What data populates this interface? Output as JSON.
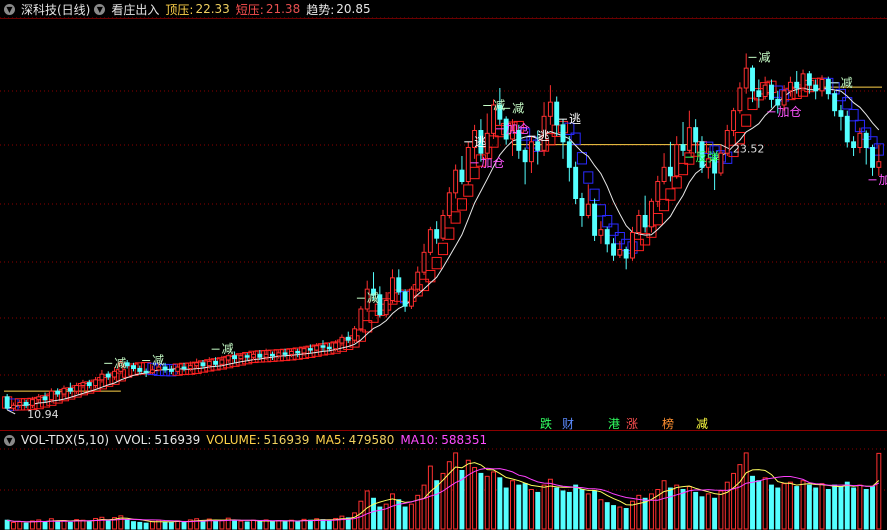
{
  "header": {
    "stock_title": "深科技(日线)",
    "indicator_name": "看庄出入",
    "top_label": "顶压:",
    "top_value": "22.33",
    "short_label": "短压:",
    "short_value": "21.38",
    "trend_label": "趋势:",
    "trend_value": "20.85"
  },
  "volume_header": {
    "indicator": "VOL-TDX(5,10)",
    "vvol_label": "VVOL:",
    "vvol_value": "516939",
    "volume_label": "VOLUME:",
    "volume_value": "516939",
    "ma5_label": "MA5:",
    "ma5_value": "479580",
    "ma10_label": "MA10:",
    "ma10_value": "588351"
  },
  "colors": {
    "up": "#ff3030",
    "down": "#54ffff",
    "box_red": "#ff2020",
    "box_blue": "#2a2aff",
    "ma_white": "#e8e8e8",
    "grid": "#8b0000",
    "label_reduce": "#c8ffc8",
    "label_escape": "#ffffff",
    "label_add": "#ff55ff",
    "label_rebound": "#30ff60",
    "ma5": "#ffff60",
    "ma10": "#ff40ff"
  },
  "chart_data": {
    "type": "candlestick",
    "high_label": "23.52",
    "low_label": "10.94",
    "signals": [
      {
        "text": "减",
        "kind": "reduce"
      },
      {
        "text": "减",
        "kind": "reduce"
      },
      {
        "text": "减",
        "kind": "reduce"
      },
      {
        "text": "减",
        "kind": "reduce"
      },
      {
        "text": "逃",
        "kind": "escape"
      },
      {
        "text": "减",
        "kind": "reduce"
      },
      {
        "text": "加仓",
        "kind": "add"
      },
      {
        "text": "加仓",
        "kind": "add"
      },
      {
        "text": "减",
        "kind": "reduce"
      },
      {
        "text": "逃",
        "kind": "escape"
      },
      {
        "text": "反弹",
        "kind": "rebound"
      },
      {
        "text": "加仓",
        "kind": "add"
      },
      {
        "text": "减",
        "kind": "reduce"
      },
      {
        "text": "加仓",
        "kind": "add"
      },
      {
        "text": "减",
        "kind": "reduce"
      },
      {
        "text": "逃",
        "kind": "escape"
      }
    ],
    "events": [
      {
        "text": "跌",
        "color": "#30ff60"
      },
      {
        "text": "财",
        "color": "#5b8bff"
      },
      {
        "text": "港",
        "color": "#30ff60"
      },
      {
        "text": "涨",
        "color": "#ff5050"
      },
      {
        "text": "榜",
        "color": "#ff9030"
      },
      {
        "text": "减",
        "color": "#ffff40"
      }
    ],
    "price_range": [
      10.3,
      24.7
    ],
    "volume_range": [
      0,
      540000
    ],
    "grid": true,
    "hlines": [
      20.3,
      22.33,
      11.6
    ],
    "candles": [
      [
        11.4,
        11.0,
        11.5,
        10.94
      ],
      [
        11.0,
        11.1,
        11.2,
        10.9
      ],
      [
        11.1,
        11.2,
        11.3,
        11.0
      ],
      [
        11.2,
        11.1,
        11.3,
        11.0
      ],
      [
        11.1,
        11.3,
        11.4,
        11.0
      ],
      [
        11.3,
        11.4,
        11.5,
        11.2
      ],
      [
        11.4,
        11.3,
        11.55,
        11.2
      ],
      [
        11.3,
        11.6,
        11.7,
        11.2
      ],
      [
        11.6,
        11.5,
        11.7,
        11.4
      ],
      [
        11.5,
        11.7,
        11.8,
        11.4
      ],
      [
        11.7,
        11.6,
        11.9,
        11.5
      ],
      [
        11.6,
        11.8,
        11.9,
        11.5
      ],
      [
        11.8,
        11.9,
        12.0,
        11.7
      ],
      [
        11.9,
        11.8,
        12.0,
        11.7
      ],
      [
        11.8,
        12.0,
        12.1,
        11.7
      ],
      [
        12.0,
        12.2,
        12.35,
        11.9
      ],
      [
        12.2,
        12.1,
        12.3,
        12.0
      ],
      [
        12.1,
        12.3,
        12.45,
        12.0
      ],
      [
        12.3,
        12.6,
        12.7,
        12.2
      ],
      [
        12.6,
        12.5,
        12.7,
        12.4
      ],
      [
        12.5,
        12.4,
        12.6,
        12.3
      ],
      [
        12.4,
        12.3,
        12.5,
        12.2
      ],
      [
        12.3,
        12.25,
        12.4,
        12.1
      ],
      [
        12.25,
        12.35,
        12.5,
        12.2
      ],
      [
        12.35,
        12.45,
        12.6,
        12.3
      ],
      [
        12.45,
        12.35,
        12.6,
        12.25
      ],
      [
        12.35,
        12.3,
        12.5,
        12.2
      ],
      [
        12.3,
        12.45,
        12.55,
        12.2
      ],
      [
        12.45,
        12.4,
        12.6,
        12.3
      ],
      [
        12.4,
        12.5,
        12.65,
        12.3
      ],
      [
        12.5,
        12.6,
        12.75,
        12.4
      ],
      [
        12.6,
        12.5,
        12.7,
        12.4
      ],
      [
        12.5,
        12.65,
        12.8,
        12.4
      ],
      [
        12.65,
        12.55,
        12.8,
        12.45
      ],
      [
        12.55,
        12.7,
        12.85,
        12.5
      ],
      [
        12.7,
        12.85,
        12.9,
        12.6
      ],
      [
        12.85,
        12.75,
        13.0,
        12.6
      ],
      [
        12.75,
        12.85,
        12.95,
        12.7
      ],
      [
        12.85,
        12.8,
        12.95,
        12.7
      ],
      [
        12.8,
        12.9,
        13.0,
        12.7
      ],
      [
        12.9,
        12.8,
        13.05,
        12.7
      ],
      [
        12.8,
        12.9,
        13.1,
        12.7
      ],
      [
        12.9,
        12.85,
        13.0,
        12.7
      ],
      [
        12.85,
        12.95,
        13.05,
        12.75
      ],
      [
        12.95,
        12.9,
        13.1,
        12.8
      ],
      [
        12.9,
        13.0,
        13.1,
        12.8
      ],
      [
        13.0,
        12.95,
        13.1,
        12.8
      ],
      [
        12.95,
        13.1,
        13.2,
        12.85
      ],
      [
        13.1,
        13.05,
        13.25,
        12.95
      ],
      [
        13.05,
        13.2,
        13.3,
        13.0
      ],
      [
        13.2,
        13.15,
        13.4,
        13.0
      ],
      [
        13.15,
        13.1,
        13.3,
        13.0
      ],
      [
        13.1,
        13.3,
        13.4,
        13.0
      ],
      [
        13.3,
        13.5,
        13.6,
        13.2
      ],
      [
        13.5,
        13.4,
        13.7,
        13.3
      ],
      [
        13.4,
        13.8,
        13.9,
        13.3
      ],
      [
        13.8,
        14.5,
        14.6,
        13.7
      ],
      [
        14.5,
        15.2,
        15.5,
        14.4
      ],
      [
        15.2,
        15.0,
        15.8,
        14.8
      ],
      [
        15.0,
        14.3,
        15.3,
        14.2
      ],
      [
        14.3,
        14.8,
        15.1,
        14.2
      ],
      [
        14.8,
        15.6,
        15.9,
        14.7
      ],
      [
        15.6,
        15.1,
        15.9,
        15.0
      ],
      [
        15.1,
        14.6,
        15.2,
        14.4
      ],
      [
        14.6,
        15.2,
        15.3,
        14.5
      ],
      [
        15.2,
        15.8,
        16.0,
        15.1
      ],
      [
        15.8,
        16.5,
        16.8,
        15.7
      ],
      [
        16.5,
        17.3,
        17.4,
        16.4
      ],
      [
        17.3,
        17.0,
        17.6,
        16.8
      ],
      [
        17.0,
        17.8,
        18.0,
        16.9
      ],
      [
        17.8,
        18.6,
        18.8,
        17.7
      ],
      [
        18.6,
        19.4,
        19.6,
        18.4
      ],
      [
        19.4,
        19.0,
        19.9,
        18.9
      ],
      [
        19.0,
        20.2,
        20.4,
        18.9
      ],
      [
        20.2,
        20.8,
        21.0,
        19.8
      ],
      [
        20.8,
        20.0,
        21.2,
        19.7
      ],
      [
        20.0,
        20.7,
        21.4,
        19.8
      ],
      [
        20.7,
        21.7,
        21.9,
        20.5
      ],
      [
        21.7,
        21.2,
        22.3,
        21.0
      ],
      [
        21.2,
        20.5,
        21.3,
        20.3
      ],
      [
        20.5,
        20.8,
        21.2,
        19.9
      ],
      [
        20.8,
        20.1,
        21.0,
        19.8
      ],
      [
        20.1,
        19.7,
        20.2,
        18.9
      ],
      [
        19.7,
        20.4,
        20.6,
        19.3
      ],
      [
        20.4,
        20.1,
        20.8,
        19.6
      ],
      [
        20.1,
        21.3,
        21.8,
        19.9
      ],
      [
        21.3,
        21.8,
        22.4,
        21.0
      ],
      [
        21.8,
        21.0,
        22.0,
        20.6
      ],
      [
        21.0,
        20.4,
        21.2,
        19.8
      ],
      [
        20.4,
        19.5,
        20.6,
        19.0
      ],
      [
        19.5,
        18.4,
        19.7,
        18.2
      ],
      [
        18.4,
        17.8,
        18.6,
        17.4
      ],
      [
        17.8,
        18.2,
        18.9,
        17.7
      ],
      [
        18.2,
        17.1,
        18.4,
        16.9
      ],
      [
        17.1,
        17.3,
        17.6,
        16.8
      ],
      [
        17.3,
        16.8,
        17.4,
        16.5
      ],
      [
        16.8,
        16.4,
        17.0,
        16.2
      ],
      [
        16.4,
        16.6,
        16.9,
        16.3
      ],
      [
        16.6,
        16.3,
        16.7,
        15.9
      ],
      [
        16.3,
        17.2,
        17.4,
        16.2
      ],
      [
        17.2,
        17.8,
        18.0,
        17.1
      ],
      [
        17.8,
        17.4,
        18.5,
        17.2
      ],
      [
        17.4,
        18.3,
        18.4,
        17.2
      ],
      [
        18.3,
        19.0,
        19.2,
        18.1
      ],
      [
        19.0,
        19.5,
        20.0,
        18.9
      ],
      [
        19.5,
        19.2,
        20.4,
        19.0
      ],
      [
        19.2,
        20.3,
        20.6,
        19.1
      ],
      [
        20.3,
        20.1,
        21.1,
        19.9
      ],
      [
        20.1,
        20.9,
        21.5,
        20.0
      ],
      [
        20.9,
        20.4,
        21.2,
        20.0
      ],
      [
        20.4,
        19.5,
        20.6,
        19.3
      ],
      [
        19.5,
        19.8,
        20.2,
        19.1
      ],
      [
        19.8,
        19.3,
        20.0,
        18.7
      ],
      [
        19.3,
        20.0,
        20.3,
        19.2
      ],
      [
        20.0,
        20.8,
        21.0,
        19.9
      ],
      [
        20.8,
        21.5,
        21.6,
        20.6
      ],
      [
        21.5,
        22.3,
        22.5,
        21.4
      ],
      [
        22.3,
        23.0,
        23.52,
        22.1
      ],
      [
        23.0,
        22.2,
        23.1,
        21.8
      ],
      [
        22.2,
        22.0,
        22.6,
        21.6
      ],
      [
        22.0,
        22.4,
        22.7,
        21.9
      ],
      [
        22.4,
        21.9,
        22.6,
        21.6
      ],
      [
        21.9,
        21.7,
        22.2,
        21.4
      ],
      [
        21.7,
        22.2,
        22.4,
        21.5
      ],
      [
        22.2,
        22.5,
        22.7,
        22.0
      ],
      [
        22.5,
        22.3,
        22.9,
        22.1
      ],
      [
        22.3,
        22.8,
        22.95,
        22.2
      ],
      [
        22.8,
        22.4,
        22.9,
        22.1
      ],
      [
        22.4,
        22.2,
        22.6,
        21.9
      ],
      [
        22.2,
        22.6,
        22.75,
        22.0
      ],
      [
        22.6,
        22.1,
        22.7,
        21.9
      ],
      [
        22.1,
        21.5,
        22.2,
        21.3
      ],
      [
        21.5,
        21.3,
        21.7,
        20.8
      ],
      [
        21.3,
        20.4,
        21.5,
        20.2
      ],
      [
        20.4,
        20.2,
        20.6,
        19.9
      ],
      [
        20.2,
        20.7,
        20.9,
        20.0
      ],
      [
        20.7,
        20.2,
        20.8,
        19.6
      ],
      [
        20.2,
        19.5,
        20.3,
        19.2
      ],
      [
        19.5,
        19.7,
        20.3,
        19.2
      ]
    ],
    "volumes": [
      60000,
      45000,
      50000,
      40000,
      55000,
      62000,
      48000,
      70000,
      52000,
      58000,
      46000,
      64000,
      60000,
      50000,
      72000,
      80000,
      55000,
      78000,
      90000,
      62000,
      50000,
      45000,
      40000,
      52000,
      60000,
      48000,
      44000,
      56000,
      50000,
      62000,
      70000,
      55000,
      68000,
      52000,
      60000,
      74000,
      58000,
      54000,
      48000,
      60000,
      52000,
      62000,
      50000,
      58000,
      54000,
      60000,
      52000,
      66000,
      60000,
      70000,
      64000,
      55000,
      72000,
      88000,
      76000,
      110000,
      190000,
      260000,
      210000,
      150000,
      170000,
      240000,
      200000,
      150000,
      170000,
      230000,
      300000,
      430000,
      330000,
      380000,
      460000,
      520000,
      400000,
      470000,
      420000,
      380000,
      360000,
      390000,
      350000,
      280000,
      330000,
      300000,
      310000,
      270000,
      250000,
      300000,
      340000,
      280000,
      260000,
      250000,
      300000,
      270000,
      240000,
      260000,
      200000,
      180000,
      160000,
      150000,
      140000,
      190000,
      230000,
      210000,
      240000,
      270000,
      330000,
      280000,
      300000,
      270000,
      290000,
      250000,
      220000,
      240000,
      210000,
      260000,
      320000,
      380000,
      440000,
      520000,
      360000,
      330000,
      350000,
      300000,
      280000,
      310000,
      320000,
      290000,
      330000,
      300000,
      280000,
      310000,
      270000,
      300000,
      290000,
      320000,
      280000,
      300000,
      270000,
      290000,
      516939
    ]
  }
}
